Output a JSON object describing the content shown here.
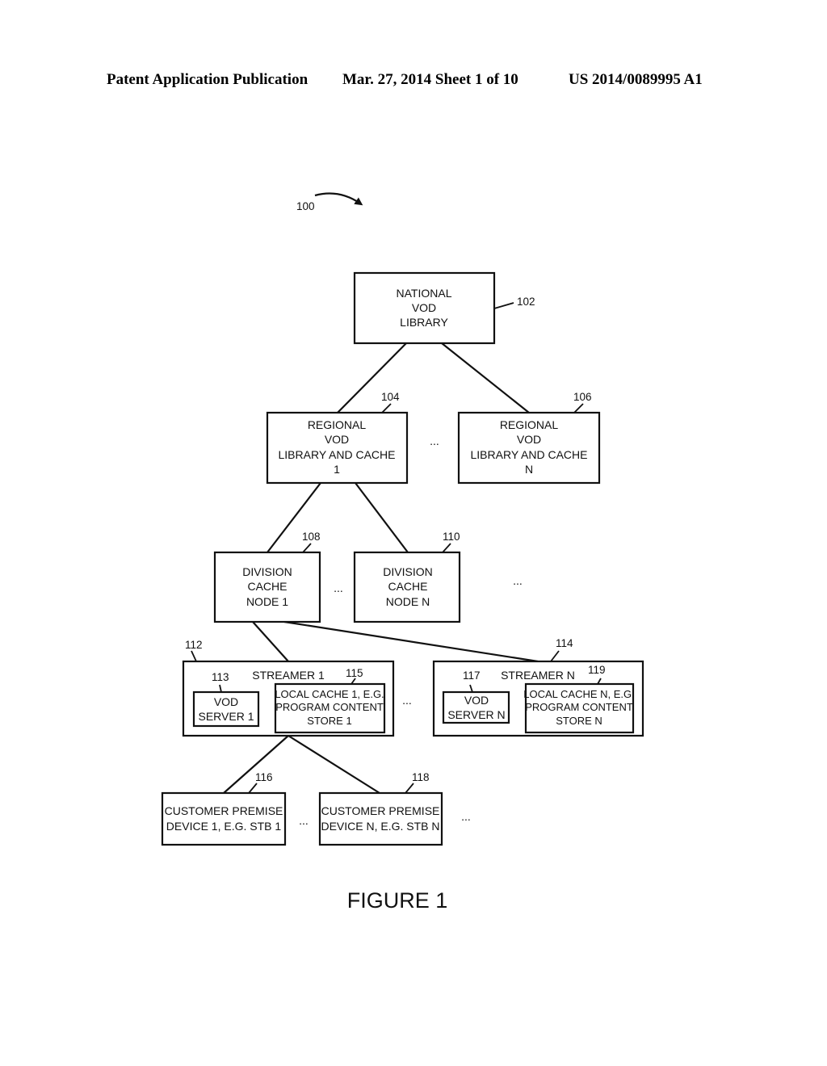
{
  "header": {
    "left": "Patent Application Publication",
    "middle": "Mar. 27, 2014  Sheet 1 of 10",
    "right": "US 2014/0089995 A1"
  },
  "figure": {
    "ref_main": "100",
    "caption": "FIGURE 1",
    "ellipsis": "...",
    "national": {
      "ref": "102",
      "lines": [
        "NATIONAL",
        "VOD",
        "LIBRARY"
      ]
    },
    "regional_1": {
      "ref": "104",
      "lines": [
        "REGIONAL",
        "VOD",
        "LIBRARY AND CACHE",
        "1"
      ]
    },
    "regional_n": {
      "ref": "106",
      "lines": [
        "REGIONAL",
        "VOD",
        "LIBRARY AND CACHE",
        "N"
      ]
    },
    "division_1": {
      "ref": "108",
      "lines": [
        "DIVISION",
        "CACHE",
        "NODE 1"
      ]
    },
    "division_n": {
      "ref": "110",
      "lines": [
        "DIVISION",
        "CACHE",
        "NODE N"
      ]
    },
    "streamer_1": {
      "ref": "112",
      "title": "STREAMER 1",
      "server": {
        "ref": "113",
        "lines": [
          "VOD",
          "SERVER 1"
        ]
      },
      "cache": {
        "ref": "115",
        "lines": [
          "LOCAL CACHE 1, E.G.",
          "PROGRAM CONTENT",
          "STORE 1"
        ]
      }
    },
    "streamer_n": {
      "ref": "114",
      "title": "STREAMER N",
      "server": {
        "ref": "117",
        "lines": [
          "VOD",
          "SERVER N"
        ]
      },
      "cache": {
        "ref": "119",
        "lines": [
          "LOCAL CACHE N, E.G.",
          "PROGRAM CONTENT",
          "STORE N"
        ]
      }
    },
    "cpe_1": {
      "ref": "116",
      "lines": [
        "CUSTOMER PREMISE",
        "DEVICE 1, E.G. STB 1"
      ]
    },
    "cpe_n": {
      "ref": "118",
      "lines": [
        "CUSTOMER PREMISE",
        "DEVICE N, E.G. STB N"
      ]
    }
  }
}
